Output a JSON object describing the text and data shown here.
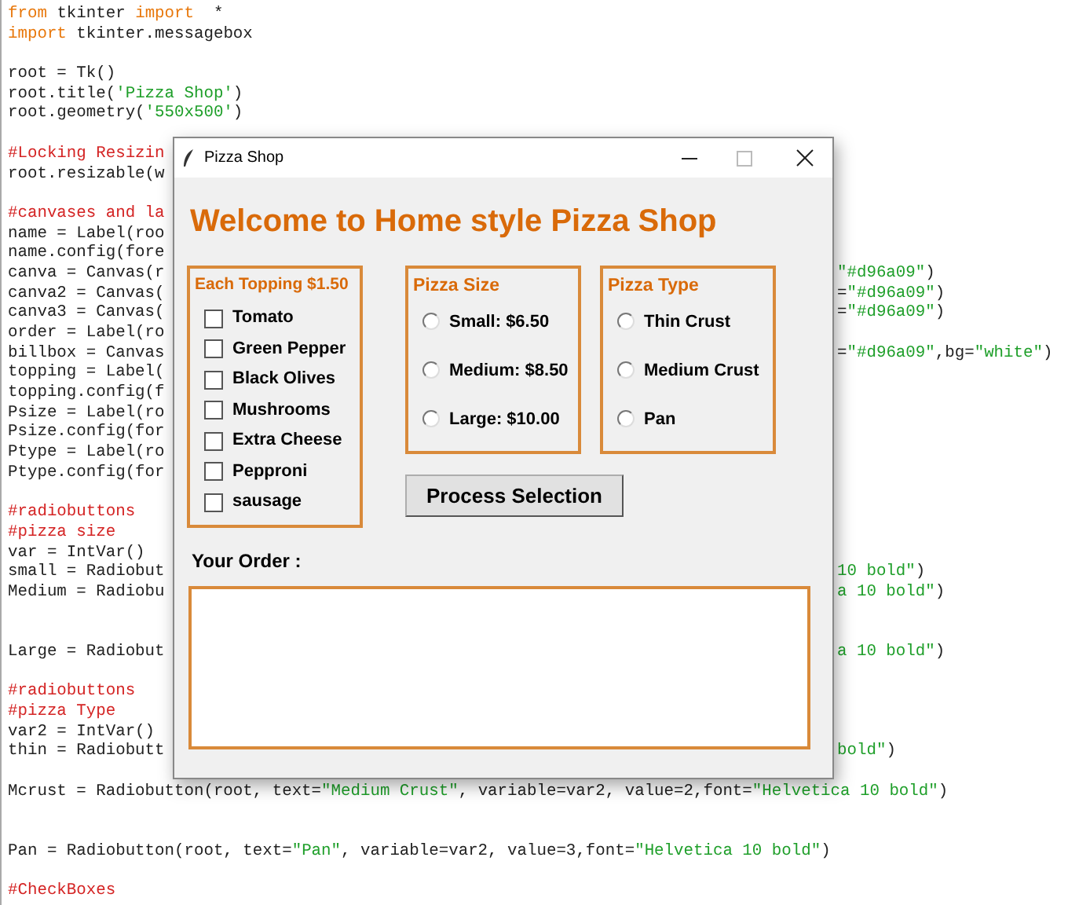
{
  "editor": {
    "lines": [
      {
        "kind": "code",
        "left": [
          {
            "kind": "keyword",
            "text": "from"
          },
          {
            "kind": "plain",
            "text": " tkinter "
          },
          {
            "kind": "keyword",
            "text": "import"
          },
          {
            "kind": "plain",
            "text": "  *"
          }
        ]
      },
      {
        "kind": "code",
        "left": [
          {
            "kind": "keyword",
            "text": "import"
          },
          {
            "kind": "plain",
            "text": " tkinter.messagebox"
          }
        ]
      },
      {
        "kind": "blank"
      },
      {
        "kind": "code",
        "left": [
          {
            "kind": "plain",
            "text": "root = Tk()"
          }
        ]
      },
      {
        "kind": "code",
        "left": [
          {
            "kind": "plain",
            "text": "root.title("
          },
          {
            "kind": "string",
            "text": "'Pizza Shop'"
          },
          {
            "kind": "plain",
            "text": ")"
          }
        ]
      },
      {
        "kind": "code",
        "left": [
          {
            "kind": "plain",
            "text": "root.geometry("
          },
          {
            "kind": "string",
            "text": "'550x500'"
          },
          {
            "kind": "plain",
            "text": ")"
          }
        ]
      },
      {
        "kind": "blank"
      },
      {
        "kind": "code",
        "left": [
          {
            "kind": "comment",
            "text": "#Locking Resizin"
          }
        ]
      },
      {
        "kind": "code",
        "left": [
          {
            "kind": "plain",
            "text": "root.resizable(w"
          }
        ]
      },
      {
        "kind": "blank"
      },
      {
        "kind": "code",
        "left": [
          {
            "kind": "comment",
            "text": "#canvases and la"
          }
        ]
      },
      {
        "kind": "code",
        "left": [
          {
            "kind": "plain",
            "text": "name = Label(roo"
          }
        ]
      },
      {
        "kind": "code",
        "left": [
          {
            "kind": "plain",
            "text": "name.config(fore"
          }
        ]
      },
      {
        "kind": "code",
        "left": [
          {
            "kind": "plain",
            "text": "canva = Canvas(r"
          }
        ],
        "right": [
          {
            "kind": "string",
            "text": "\"#d96a09\""
          },
          {
            "kind": "plain",
            "text": ")"
          }
        ]
      },
      {
        "kind": "code",
        "left": [
          {
            "kind": "plain",
            "text": "canva2 = Canvas("
          }
        ],
        "right": [
          {
            "kind": "plain",
            "text": "="
          },
          {
            "kind": "string",
            "text": "\"#d96a09\""
          },
          {
            "kind": "plain",
            "text": ")"
          }
        ]
      },
      {
        "kind": "code",
        "left": [
          {
            "kind": "plain",
            "text": "canva3 = Canvas("
          }
        ],
        "right": [
          {
            "kind": "plain",
            "text": "="
          },
          {
            "kind": "string",
            "text": "\"#d96a09\""
          },
          {
            "kind": "plain",
            "text": ")"
          }
        ]
      },
      {
        "kind": "code",
        "left": [
          {
            "kind": "plain",
            "text": "order = Label(ro"
          }
        ]
      },
      {
        "kind": "code",
        "left": [
          {
            "kind": "plain",
            "text": "billbox = Canvas"
          }
        ],
        "right": [
          {
            "kind": "plain",
            "text": "="
          },
          {
            "kind": "string",
            "text": "\"#d96a09\""
          },
          {
            "kind": "plain",
            "text": ",bg="
          },
          {
            "kind": "string",
            "text": "\"white\""
          },
          {
            "kind": "plain",
            "text": ")"
          }
        ]
      },
      {
        "kind": "code",
        "left": [
          {
            "kind": "plain",
            "text": "topping = Label("
          }
        ]
      },
      {
        "kind": "code",
        "left": [
          {
            "kind": "plain",
            "text": "topping.config(f"
          }
        ]
      },
      {
        "kind": "code",
        "left": [
          {
            "kind": "plain",
            "text": "Psize = Label(ro"
          }
        ]
      },
      {
        "kind": "code",
        "left": [
          {
            "kind": "plain",
            "text": "Psize.config(for"
          }
        ]
      },
      {
        "kind": "code",
        "left": [
          {
            "kind": "plain",
            "text": "Ptype = Label(ro"
          }
        ]
      },
      {
        "kind": "code",
        "left": [
          {
            "kind": "plain",
            "text": "Ptype.config(for"
          }
        ]
      },
      {
        "kind": "blank"
      },
      {
        "kind": "code",
        "left": [
          {
            "kind": "comment",
            "text": "#radiobuttons"
          }
        ]
      },
      {
        "kind": "code",
        "left": [
          {
            "kind": "comment",
            "text": "#pizza size"
          }
        ]
      },
      {
        "kind": "code",
        "left": [
          {
            "kind": "plain",
            "text": "var = IntVar()"
          }
        ]
      },
      {
        "kind": "code",
        "left": [
          {
            "kind": "plain",
            "text": "small = Radiobut"
          }
        ],
        "right": [
          {
            "kind": "string",
            "text": "10 bold\""
          },
          {
            "kind": "plain",
            "text": ")"
          }
        ]
      },
      {
        "kind": "code",
        "left": [
          {
            "kind": "plain",
            "text": "Medium = Radiobu"
          }
        ],
        "right": [
          {
            "kind": "string",
            "text": "a 10 bold\""
          },
          {
            "kind": "plain",
            "text": ")"
          }
        ]
      },
      {
        "kind": "blank"
      },
      {
        "kind": "blank"
      },
      {
        "kind": "code",
        "left": [
          {
            "kind": "plain",
            "text": "Large = Radiobut"
          }
        ],
        "right": [
          {
            "kind": "string",
            "text": "a 10 bold\""
          },
          {
            "kind": "plain",
            "text": ")"
          }
        ]
      },
      {
        "kind": "blank"
      },
      {
        "kind": "code",
        "left": [
          {
            "kind": "comment",
            "text": "#radiobuttons"
          }
        ]
      },
      {
        "kind": "code",
        "left": [
          {
            "kind": "comment",
            "text": "#pizza Type"
          }
        ]
      },
      {
        "kind": "code",
        "left": [
          {
            "kind": "plain",
            "text": "var2 = IntVar()"
          }
        ]
      },
      {
        "kind": "code",
        "left": [
          {
            "kind": "plain",
            "text": "thin = Radiobutt"
          }
        ],
        "right": [
          {
            "kind": "string",
            "text": "bold\""
          },
          {
            "kind": "plain",
            "text": ")"
          }
        ]
      },
      {
        "kind": "blank"
      },
      {
        "kind": "code",
        "left": [
          {
            "kind": "plain",
            "text": "Mcrust = Radiobutton(root, text="
          },
          {
            "kind": "string",
            "text": "\"Medium Crust\""
          },
          {
            "kind": "plain",
            "text": ", variable=var2, value=2,font="
          },
          {
            "kind": "string",
            "text": "\"Helvetica 10 bold\""
          },
          {
            "kind": "plain",
            "text": ")"
          }
        ]
      },
      {
        "kind": "blank"
      },
      {
        "kind": "blank"
      },
      {
        "kind": "code",
        "left": [
          {
            "kind": "plain",
            "text": "Pan = Radiobutton(root, text="
          },
          {
            "kind": "string",
            "text": "\"Pan\""
          },
          {
            "kind": "plain",
            "text": ", variable=var2, value=3,font="
          },
          {
            "kind": "string",
            "text": "\"Helvetica 10 bold\""
          },
          {
            "kind": "plain",
            "text": ")"
          }
        ]
      },
      {
        "kind": "blank"
      },
      {
        "kind": "code",
        "left": [
          {
            "kind": "comment",
            "text": "#CheckBoxes"
          }
        ]
      }
    ]
  },
  "window": {
    "title": "Pizza Shop",
    "heading": "Welcome to Home style Pizza Shop",
    "toppings": {
      "title": "Each Topping $1.50",
      "items": [
        {
          "label": "Tomato",
          "checked": false
        },
        {
          "label": "Green Pepper",
          "checked": false
        },
        {
          "label": "Black Olives",
          "checked": false
        },
        {
          "label": "Mushrooms",
          "checked": false
        },
        {
          "label": "Extra Cheese",
          "checked": false
        },
        {
          "label": "Pepproni",
          "checked": false
        },
        {
          "label": "sausage",
          "checked": false
        }
      ]
    },
    "sizes": {
      "title": "Pizza Size",
      "items": [
        {
          "label": "Small: $6.50",
          "selected": false
        },
        {
          "label": "Medium: $8.50",
          "selected": false
        },
        {
          "label": "Large: $10.00",
          "selected": false
        }
      ]
    },
    "types": {
      "title": "Pizza Type",
      "items": [
        {
          "label": "Thin Crust",
          "selected": false
        },
        {
          "label": "Medium Crust",
          "selected": false
        },
        {
          "label": "Pan",
          "selected": false
        }
      ]
    },
    "button": "Process Selection",
    "order_label": "Your Order :"
  }
}
